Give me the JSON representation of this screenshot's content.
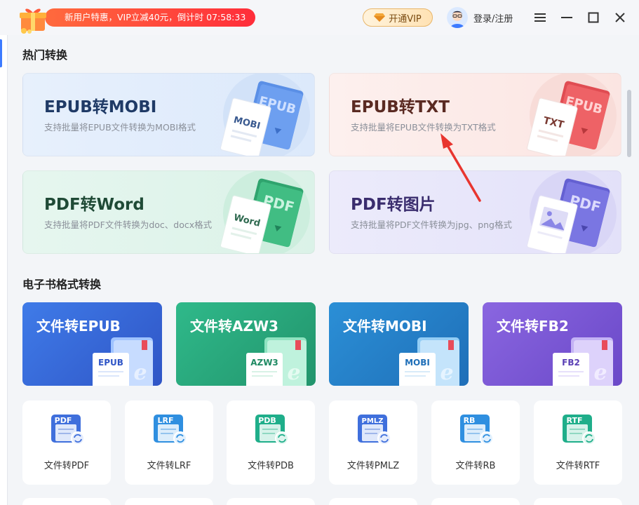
{
  "topbar": {
    "promo_text": "新用户特惠，VIP立减40元，倒计时 07:58:33",
    "vip_label": "开通VIP",
    "login_label": "登录/注册",
    "icons": [
      "gift-icon",
      "diamond-icon",
      "avatar",
      "menu-icon",
      "minimize-icon",
      "maximize-icon",
      "close-icon"
    ]
  },
  "sections": {
    "hot": "热门转换",
    "ebook": "电子书格式转换"
  },
  "hot_cards": [
    {
      "title": "EPUB转MOBI",
      "desc": "支持批量将EPUB文件转换为MOBI格式",
      "doc_label": "MOBI",
      "book_label": "EPUB",
      "title_color": "#1f3a66",
      "accent": "#4f86e0"
    },
    {
      "title": "EPUB转TXT",
      "desc": "支持批量将EPUB文件转换为TXT格式",
      "doc_label": "TXT",
      "book_label": "EPUB",
      "title_color": "#5a2a22",
      "accent": "#e2555a"
    },
    {
      "title": "PDF转Word",
      "desc": "支持批量将PDF文件转换为doc、docx格式",
      "doc_label": "Word",
      "book_label": "PDF",
      "title_color": "#1f4a36",
      "accent": "#37b27a"
    },
    {
      "title": "PDF转图片",
      "desc": "支持批量将PDF文件转换为jpg、png格式",
      "doc_label": "",
      "book_label": "PDF",
      "title_color": "#3a2d6e",
      "accent": "#6a66d8"
    }
  ],
  "ebook_cards": [
    {
      "title": "文件转EPUB",
      "tag": "EPUB"
    },
    {
      "title": "文件转AZW3",
      "tag": "AZW3"
    },
    {
      "title": "文件转MOBI",
      "tag": "MOBI"
    },
    {
      "title": "文件转FB2",
      "tag": "FB2"
    }
  ],
  "tools": [
    {
      "label": "文件转PDF",
      "tag": "PDF",
      "color": "#3f6fdc"
    },
    {
      "label": "文件转LRF",
      "tag": "LRF",
      "color": "#2f8fe0"
    },
    {
      "label": "文件转PDB",
      "tag": "PDB",
      "color": "#1fae8a"
    },
    {
      "label": "文件转PMLZ",
      "tag": "PMLZ",
      "color": "#3f6fdc"
    },
    {
      "label": "文件转RB",
      "tag": "RB",
      "color": "#2f8fe0"
    },
    {
      "label": "文件转RTF",
      "tag": "RTF",
      "color": "#1fae8a"
    }
  ]
}
